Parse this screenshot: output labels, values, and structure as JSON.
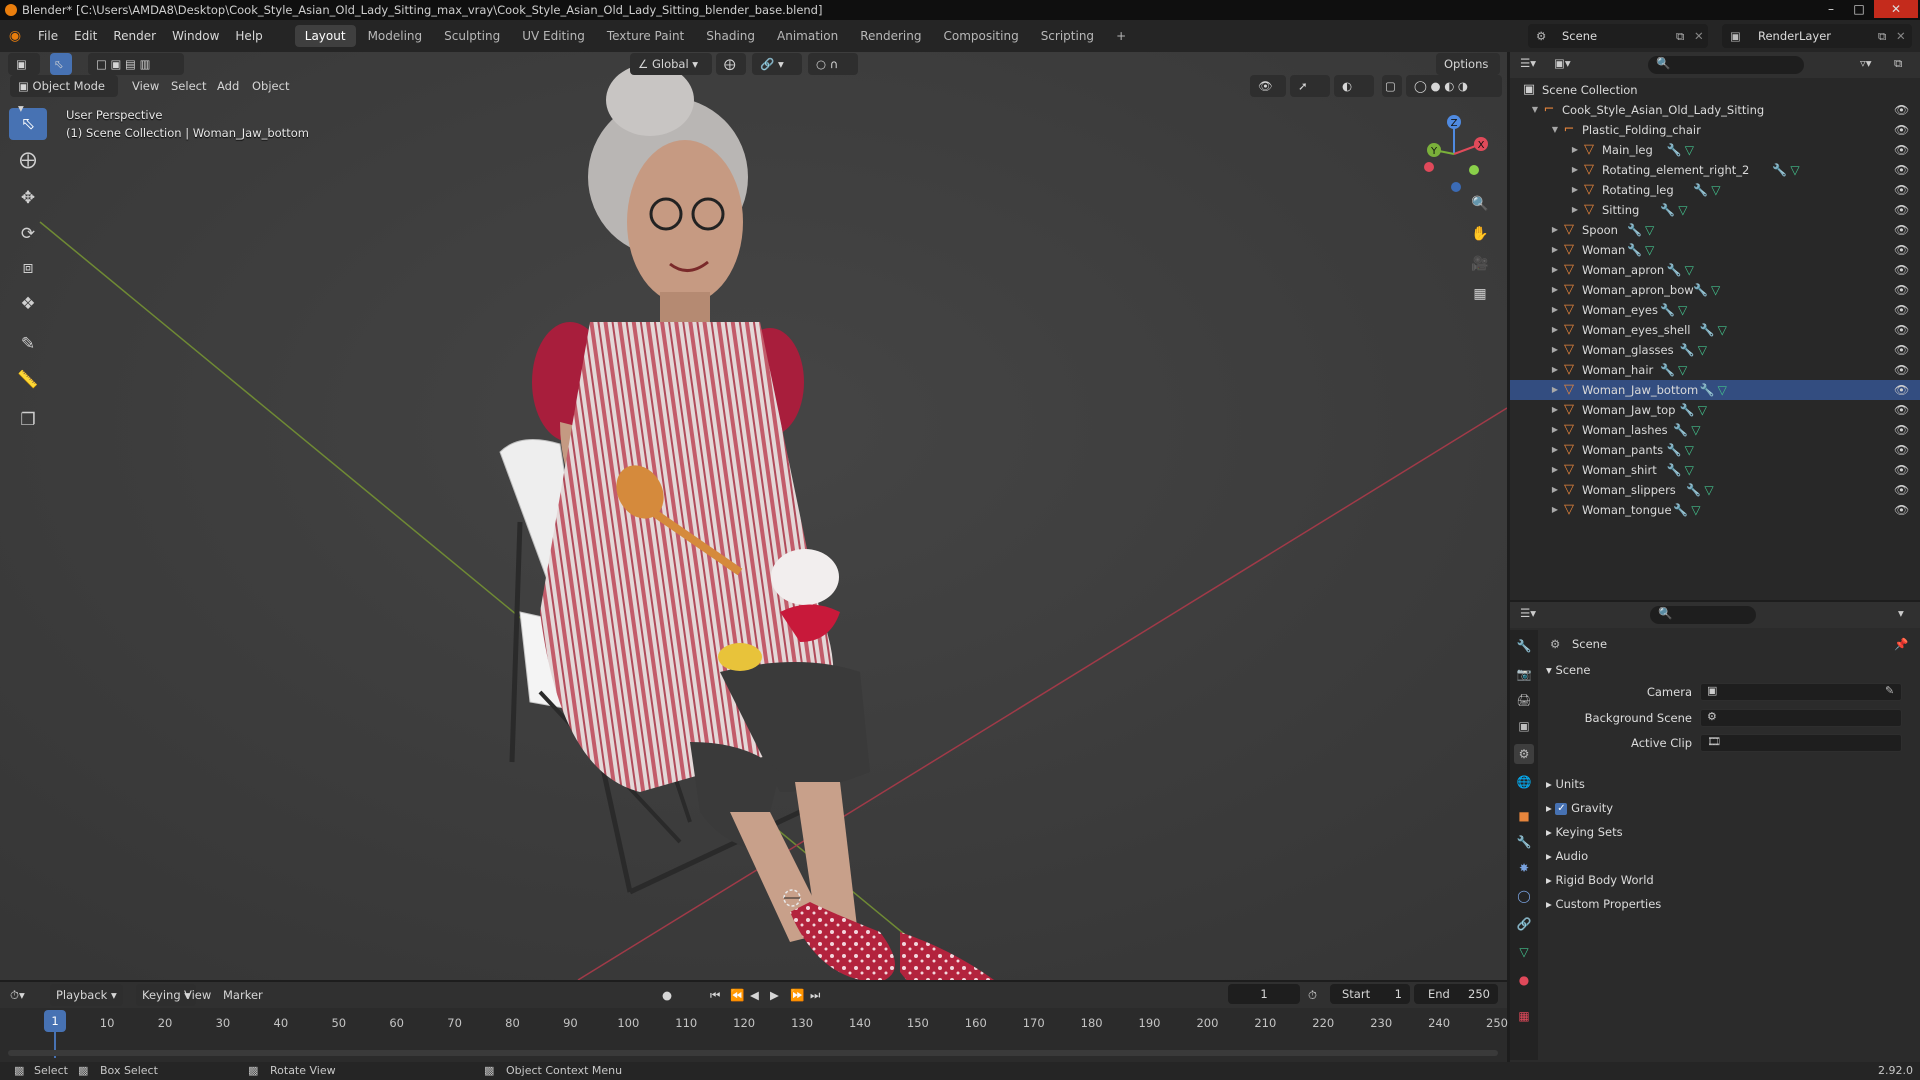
{
  "window": {
    "title": "Blender* [C:\\Users\\AMDA8\\Desktop\\Cook_Style_Asian_Old_Lady_Sitting_max_vray\\Cook_Style_Asian_Old_Lady_Sitting_blender_base.blend]"
  },
  "menu": [
    "File",
    "Edit",
    "Render",
    "Window",
    "Help"
  ],
  "workspaces": [
    "Layout",
    "Modeling",
    "Sculpting",
    "UV Editing",
    "Texture Paint",
    "Shading",
    "Animation",
    "Rendering",
    "Compositing",
    "Scripting"
  ],
  "active_workspace": "Layout",
  "scene_selector": "Scene",
  "view_layer": "RenderLayer",
  "viewport": {
    "mode": "Object Mode",
    "menus": [
      "View",
      "Select",
      "Add",
      "Object"
    ],
    "orientation": "Global",
    "options_label": "Options",
    "perspective": "User Perspective",
    "context": "(1) Scene Collection | Woman_Jaw_bottom",
    "gizmo_axes": {
      "x": "X",
      "y": "Y",
      "z": "Z"
    }
  },
  "outliner": {
    "root": "Scene Collection",
    "collection": "Cook_Style_Asian_Old_Lady_Sitting",
    "chair": "Plastic_Folding_chair",
    "chair_children": [
      "Main_leg",
      "Rotating_element_right_2",
      "Rotating_leg",
      "Sitting"
    ],
    "objects": [
      "Spoon",
      "Woman",
      "Woman_apron",
      "Woman_apron_bow",
      "Woman_eyes",
      "Woman_eyes_shell",
      "Woman_glasses",
      "Woman_hair",
      "Woman_Jaw_bottom",
      "Woman_Jaw_top",
      "Woman_lashes",
      "Woman_pants",
      "Woman_shirt",
      "Woman_slippers",
      "Woman_tongue"
    ],
    "selected": "Woman_Jaw_bottom"
  },
  "properties": {
    "title": "Scene",
    "panel": "Scene",
    "fields": [
      {
        "label": "Camera",
        "value": ""
      },
      {
        "label": "Background Scene",
        "value": ""
      },
      {
        "label": "Active Clip",
        "value": ""
      }
    ],
    "sections": [
      "Units",
      "Gravity",
      "Keying Sets",
      "Audio",
      "Rigid Body World",
      "Custom Properties"
    ],
    "gravity_checked": true
  },
  "timeline": {
    "menus": [
      "Playback",
      "Keying",
      "View",
      "Marker"
    ],
    "current_frame": "1",
    "start_label": "Start",
    "start": "1",
    "end_label": "End",
    "end": "250",
    "ticks": [
      "10",
      "20",
      "30",
      "40",
      "50",
      "60",
      "70",
      "80",
      "90",
      "100",
      "110",
      "120",
      "130",
      "140",
      "150",
      "160",
      "170",
      "180",
      "190",
      "200",
      "210",
      "220",
      "230",
      "240",
      "250"
    ],
    "playhead": "1"
  },
  "statusbar": {
    "select": "Select",
    "box_select": "Box Select",
    "rotate": "Rotate View",
    "context_menu": "Object Context Menu",
    "version": "2.92.0"
  }
}
